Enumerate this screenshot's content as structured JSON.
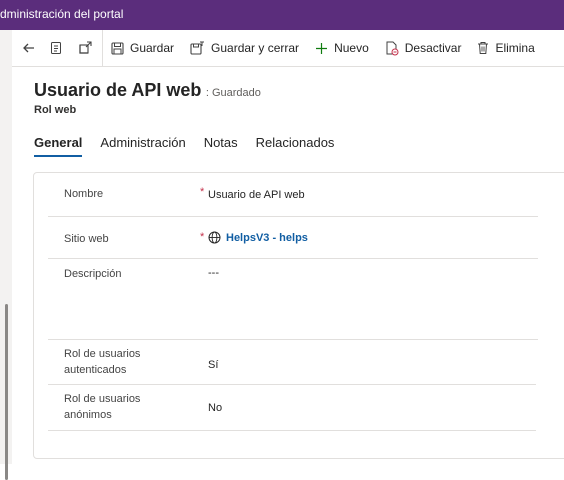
{
  "app": {
    "title": "dministración del portal"
  },
  "toolbar": {
    "back_label": "",
    "items": [
      {
        "label": "",
        "icon": "page-icon"
      },
      {
        "label": "",
        "icon": "popout-icon"
      },
      {
        "label": "Guardar",
        "icon": "save-icon"
      },
      {
        "label": "Guardar y cerrar",
        "icon": "save-close-icon"
      },
      {
        "label": "Nuevo",
        "icon": "plus-icon"
      },
      {
        "label": "Desactivar",
        "icon": "deactivate-icon"
      },
      {
        "label": "Elimina",
        "icon": "trash-icon"
      }
    ]
  },
  "record": {
    "name": "Usuario de API web",
    "status": ": Guardado",
    "subtitle": "Rol web"
  },
  "tabs": [
    {
      "label": "General",
      "active": true
    },
    {
      "label": "Administración",
      "active": false
    },
    {
      "label": "Notas",
      "active": false
    },
    {
      "label": "Relacionados",
      "active": false
    }
  ],
  "form": {
    "required_marker": "*",
    "fields": {
      "nombre": {
        "label": "Nombre",
        "value": "Usuario de API web"
      },
      "sitio_web": {
        "label": "Sitio web",
        "value": "HelpsV3 - helps",
        "icon": "globe-icon"
      },
      "descripcion": {
        "label": "Descripción",
        "value": "---"
      },
      "rol_autenticados": {
        "label_line1": "Rol de usuarios",
        "label_line2": "autenticados",
        "value": "Sí"
      },
      "rol_anonimos": {
        "label_line1": "Rol de usuarios",
        "label_line2": "anónimos",
        "value": "No"
      }
    }
  },
  "colors": {
    "topbar": "#5b2d7c",
    "accent": "#115ea3",
    "required": "#c4314b",
    "new_icon": "#107c10"
  }
}
